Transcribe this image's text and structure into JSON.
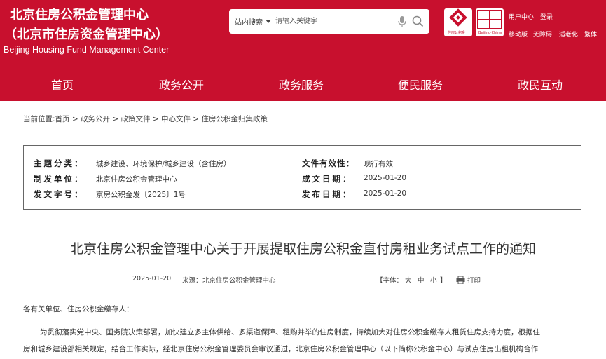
{
  "header": {
    "title_line1": "北京住房公积金管理中心",
    "title_line2": "（北京市住房资金管理中心）",
    "title_en": "Beijing Housing Fund Management Center",
    "search_scope": "站内搜索",
    "search_placeholder": "请输入关键字",
    "badge1_text": "住房公积金",
    "badge2_text": "首都之窗",
    "badge2_sub": "Beijing·China",
    "links_row1": [
      "用户中心",
      "登录"
    ],
    "links_row2": [
      "移动版",
      "无障碍",
      "适老化",
      "繁体"
    ]
  },
  "nav": {
    "items": [
      "首页",
      "政务公开",
      "政务服务",
      "便民服务",
      "政民互动"
    ]
  },
  "breadcrumb": "当前位置:首页 > 政务公开 > 政策文件 > 中心文件 > 住房公积金归集政策",
  "meta": {
    "topic_label": "主题分类：",
    "topic_value": "城乡建设、环境保护/城乡建设（含住房）",
    "issuer_label": "制发单位：",
    "issuer_value": "北京住房公积金管理中心",
    "docno_label": "发文字号：",
    "docno_value": "京房公积金发〔2025〕1号",
    "validity_label": "文件有效性：",
    "validity_value": "现行有效",
    "created_label": "成文日期：",
    "created_value": "2025-01-20",
    "published_label": "发布日期：",
    "published_value": "2025-01-20"
  },
  "article": {
    "title": "北京住房公积金管理中心关于开展提取住房公积金直付房租业务试点工作的通知",
    "date": "2025-01-20",
    "source_label": "来源：",
    "source_value": "北京住房公积金管理中心",
    "font_label": "【字体：",
    "font_large": "大",
    "font_medium": "中",
    "font_small": "小",
    "font_close": "】",
    "print_label": "打印",
    "salutation": "各有关单位、住房公积金缴存人：",
    "para1_line1": "为贯彻落实党中央、国务院决策部署，加快建立多主体供给、多渠道保障、租购并举的住房制度，持续加大对住房公积金缴存人租赁住房支持力度，根据住",
    "para1_line2": "房和城乡建设部相关规定，结合工作实际，经北京住房公积金管理委员会审议通过，北京住房公积金管理中心（以下简称公积金中心）与试点住房出租机构合作"
  },
  "colors": {
    "brand_red": "#c8102e"
  }
}
